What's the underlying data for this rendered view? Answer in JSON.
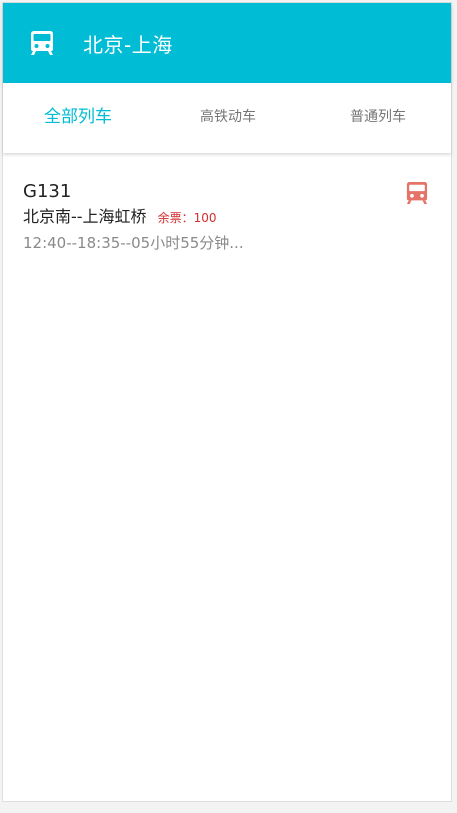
{
  "app_bar": {
    "title": "北京-上海",
    "icon": "train-icon",
    "color": "#00bcd4"
  },
  "tabs": [
    {
      "label": "全部列车",
      "active": true
    },
    {
      "label": "高铁动车",
      "active": false
    },
    {
      "label": "普通列车",
      "active": false
    }
  ],
  "trains": [
    {
      "number": "G131",
      "route": "北京南--上海虹桥",
      "tickets": "余票：100",
      "time": "12:40--18:35--05小时55分钟...",
      "icon": "train-icon",
      "icon_color": "#e57368"
    }
  ]
}
